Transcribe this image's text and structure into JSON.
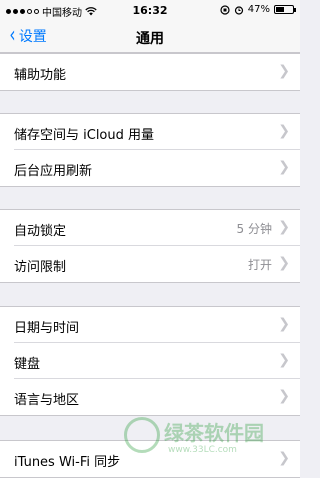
{
  "status_bar": {
    "carrier": "中国移动",
    "time": "16:32",
    "battery": "47%",
    "battery_level": 0.47
  },
  "nav": {
    "back_label": "设置",
    "title": "通用"
  },
  "groups": [
    {
      "rows": [
        {
          "label": "辅助功能"
        }
      ]
    },
    {
      "rows": [
        {
          "label": "储存空间与 iCloud 用量"
        },
        {
          "label": "后台应用刷新"
        }
      ]
    },
    {
      "rows": [
        {
          "label": "自动锁定",
          "value": "5 分钟"
        },
        {
          "label": "访问限制",
          "value": "打开"
        }
      ]
    },
    {
      "rows": [
        {
          "label": "日期与时间"
        },
        {
          "label": "键盘"
        },
        {
          "label": "语言与地区"
        }
      ]
    },
    {
      "rows": [
        {
          "label": "iTunes Wi-Fi 同步"
        }
      ]
    }
  ],
  "watermark": {
    "brand": "绿茶软件园",
    "url": "www.33LC.com"
  }
}
